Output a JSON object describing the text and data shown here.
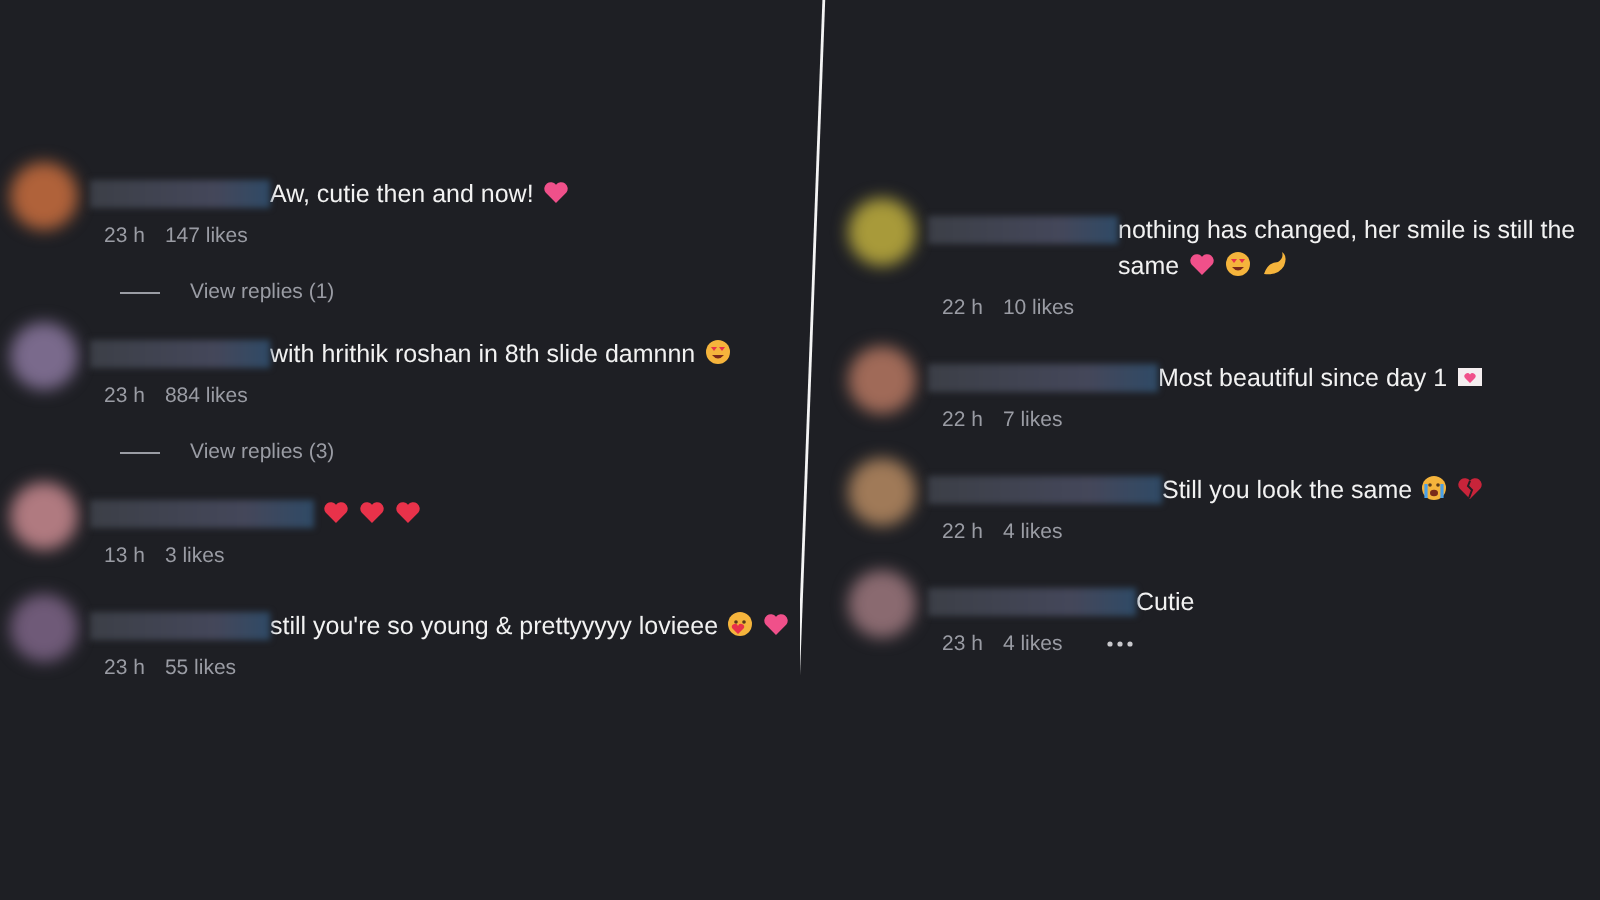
{
  "panels": [
    {
      "comments": [
        {
          "color": "#b0623a",
          "text": "Aw, cutie then and now!",
          "emojis": [
            {
              "kind": "heart"
            }
          ],
          "time": "23 h",
          "likes": "147 likes",
          "replies": "View replies (1)"
        },
        {
          "color": "#7a6a8c",
          "text": "with hrithik roshan in 8th slide damnnn",
          "emojis": [
            {
              "kind": "heart-eyes"
            }
          ],
          "time": "23 h",
          "likes": "884 likes",
          "replies": "View replies (3)"
        },
        {
          "color": "#b07a80",
          "emojis": [
            {
              "kind": "red-heart"
            },
            {
              "kind": "red-heart"
            },
            {
              "kind": "red-heart"
            }
          ],
          "time": "13 h",
          "likes": "3 likes"
        },
        {
          "color": "#6f5a78",
          "text": "still you're so young & prettyyyyy lovieee",
          "emojis": [
            {
              "kind": "kiss"
            },
            {
              "kind": "heart"
            }
          ],
          "time": "23 h",
          "likes": "55 likes"
        }
      ]
    },
    {
      "comments": [
        {
          "color": "#a89a3a",
          "text": "nothing has changed, her smile is still the same",
          "emojis": [
            {
              "kind": "heart"
            },
            {
              "kind": "heart-eyes"
            },
            {
              "kind": "arm"
            }
          ],
          "time": "22 h",
          "likes": "10 likes"
        },
        {
          "color": "#a06a58",
          "text": "Most beautiful since day 1",
          "emojis": [
            {
              "kind": "heart-letter"
            }
          ],
          "time": "22 h",
          "likes": "7 likes"
        },
        {
          "color": "#a07a58",
          "text": "Still you look the same",
          "emojis": [
            {
              "kind": "crying"
            },
            {
              "kind": "broken-heart"
            }
          ],
          "time": "22 h",
          "likes": "4 likes"
        },
        {
          "color": "#8a6a70",
          "text": "Cutie",
          "time": "23 h",
          "likes": "4 likes",
          "more": true
        }
      ]
    }
  ]
}
